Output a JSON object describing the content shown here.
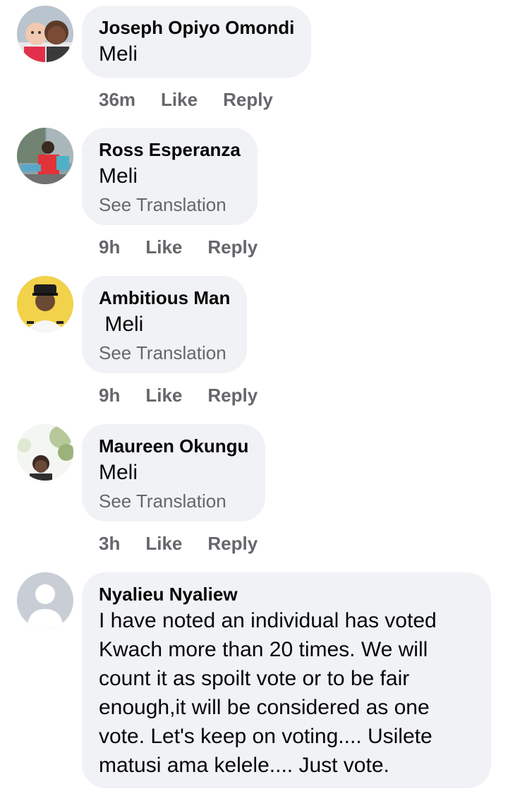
{
  "comments": [
    {
      "author": "Joseph Opiyo Omondi",
      "text": "Meli",
      "time": "36m",
      "like_label": "Like",
      "reply_label": "Reply"
    },
    {
      "author": "Ross Esperanza",
      "text": "Meli",
      "see_translation": "See Translation",
      "time": "9h",
      "like_label": "Like",
      "reply_label": "Reply"
    },
    {
      "author": "Ambitious Man",
      "text": " Meli",
      "see_translation": "See Translation",
      "time": "9h",
      "like_label": "Like",
      "reply_label": "Reply"
    },
    {
      "author": "Maureen Okungu",
      "text": "Meli",
      "see_translation": "See Translation",
      "time": "3h",
      "like_label": "Like",
      "reply_label": "Reply"
    },
    {
      "author": "Nyalieu Nyaliew",
      "text_lines": [
        "I have noted an individual has voted",
        "Kwach more than 20 times. We will",
        "count it as spoilt vote or to be fair",
        "enough,it will be considered as one",
        "vote. Let's keep on voting.... Usilete",
        "matusi ama kelele.... Just vote."
      ]
    }
  ],
  "colors": {
    "bubble": "#f0f2f5",
    "secondary_text": "#65676b",
    "primary_text": "#050505"
  }
}
